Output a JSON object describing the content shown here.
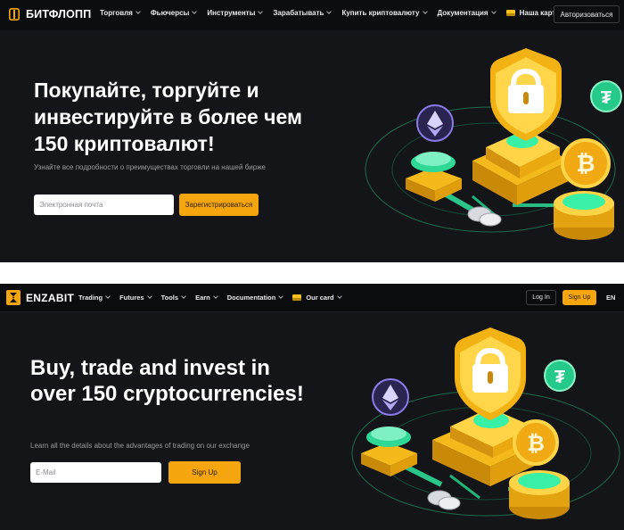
{
  "ru": {
    "logo_text": "БИТФЛОПП",
    "nav": [
      "Торговля",
      "Фьючерсы",
      "Инструменты",
      "Зарабатывать",
      "Купить криптовалюту",
      "Документация"
    ],
    "card_label": "Наша карта",
    "login_label": "Авторизоваться",
    "hero_title": "Покупайте, торгуйте и инвестируйте в более чем 150 криптовалют!",
    "hero_subtitle": "Узнайте все подробности о преимуществах торговли на нашей бирже",
    "email_placeholder": "Электронная почта",
    "cta_label": "Зарегистрироваться"
  },
  "en": {
    "logo_text": "ENZABIT",
    "nav": [
      "Trading",
      "Futures",
      "Tools",
      "Earn",
      "Documentation"
    ],
    "card_label": "Our card",
    "login_label": "Log In",
    "signup_label": "Sign Up",
    "lang_label": "EN",
    "hero_title": "Buy, trade and invest in over 150 cryptocurrencies!",
    "hero_subtitle": "Learn all the details about the advantages of trading on our exchange",
    "email_placeholder": "E-Mail",
    "cta_label": "Sign Up"
  },
  "colors": {
    "background": "#141518",
    "accent": "#f5a60f",
    "shield_gold": "#f7c21e",
    "crypto_green": "#2ee59d",
    "ethereum_violet": "#8b7be8"
  },
  "illustration": {
    "icons": [
      "shield-lock-icon",
      "ethereum-icon",
      "bitcoin-icon",
      "tether-icon"
    ]
  }
}
